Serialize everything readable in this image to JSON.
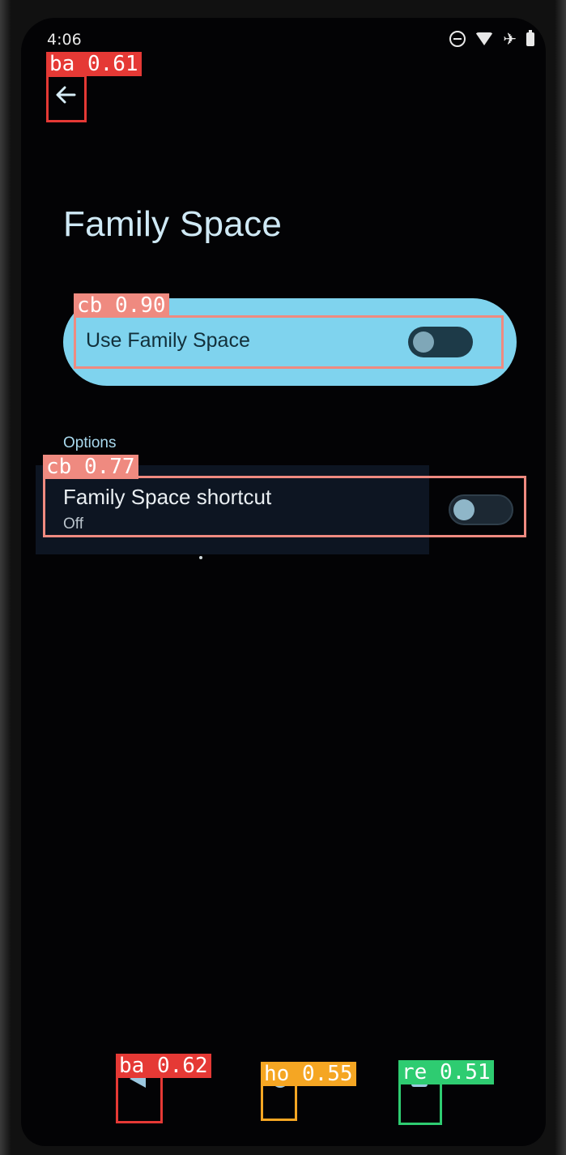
{
  "status_bar": {
    "time": "4:06",
    "icons": [
      "do-not-disturb-icon",
      "wifi-icon",
      "airplane-icon",
      "battery-icon"
    ]
  },
  "header": {
    "back_icon": "arrow-left-icon",
    "title": "Family Space"
  },
  "main_toggle": {
    "label": "Use Family Space",
    "enabled": false
  },
  "options": {
    "section_label": "Options",
    "items": [
      {
        "title": "Family Space shortcut",
        "subtitle": "Off",
        "enabled": false
      }
    ]
  },
  "nav_bar": {
    "back_icon": "triangle-back-icon",
    "home_icon": "circle-home-icon",
    "recents_icon": "square-recents-icon"
  },
  "detections": [
    {
      "label": "ba 0.61"
    },
    {
      "label": "cb 0.90"
    },
    {
      "label": "cb 0.77"
    },
    {
      "label": "ba 0.62"
    },
    {
      "label": "ho 0.55"
    },
    {
      "label": "re 0.51"
    }
  ],
  "colors": {
    "screen_bg": "#030305",
    "accent_card": "#7fd3ee",
    "title_text": "#cfe9f5",
    "det_red": "#e53935",
    "det_salmon": "#ef8a80",
    "det_orange": "#f5a623",
    "det_green": "#2ecc71"
  }
}
